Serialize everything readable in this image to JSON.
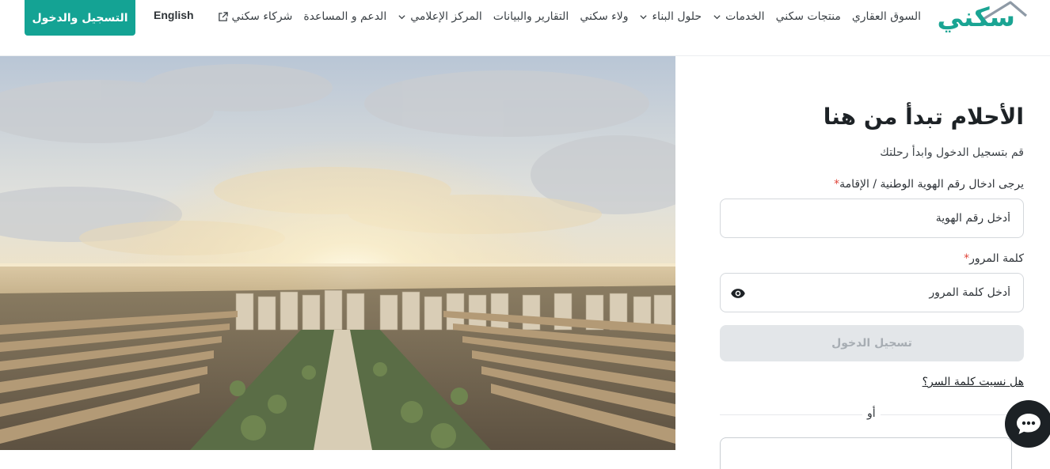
{
  "header": {
    "logo_text": "سكني",
    "nav_items": [
      {
        "label": "السوق العقاري",
        "has_dropdown": false,
        "external": false
      },
      {
        "label": "منتجات سكني",
        "has_dropdown": false,
        "external": false
      },
      {
        "label": "الخدمات",
        "has_dropdown": true,
        "external": false
      },
      {
        "label": "حلول البناء",
        "has_dropdown": true,
        "external": false
      },
      {
        "label": "ولاء سكني",
        "has_dropdown": false,
        "external": false
      },
      {
        "label": "التقارير والبيانات",
        "has_dropdown": false,
        "external": false
      },
      {
        "label": "المركز الإعلامي",
        "has_dropdown": true,
        "external": false
      },
      {
        "label": "الدعم و المساعدة",
        "has_dropdown": false,
        "external": false
      },
      {
        "label": "شركاء سكني",
        "has_dropdown": false,
        "external": true
      }
    ],
    "language_toggle": "English",
    "cta_label": "التسجيل والدخول"
  },
  "login": {
    "title": "الأحلام تبدأ من هنا",
    "subtitle": "قم بتسجيل الدخول وابدأ رحلتك",
    "id_label": "يرجى ادخال رقم الهوية الوطنية / الإقامة",
    "id_placeholder": "أدخل رقم الهوية",
    "id_value": "",
    "password_label": "كلمة المرور",
    "password_placeholder": "أدخل كلمة المرور",
    "password_value": "",
    "required_mark": "*",
    "submit_label": "تسجيل الدخول",
    "forgot_label": "هل نسيت كلمة السر؟",
    "or_label": "أو"
  },
  "icons": {
    "external_link": "external-link-icon",
    "dropdown": "chevron-down-icon",
    "password_toggle": "eye-icon",
    "chat": "chat-bubble-icon"
  },
  "colors": {
    "brand": "#14a394",
    "required": "#e0453a",
    "disabled_button": "#e3e6e9",
    "chat_button": "#1c2125"
  }
}
